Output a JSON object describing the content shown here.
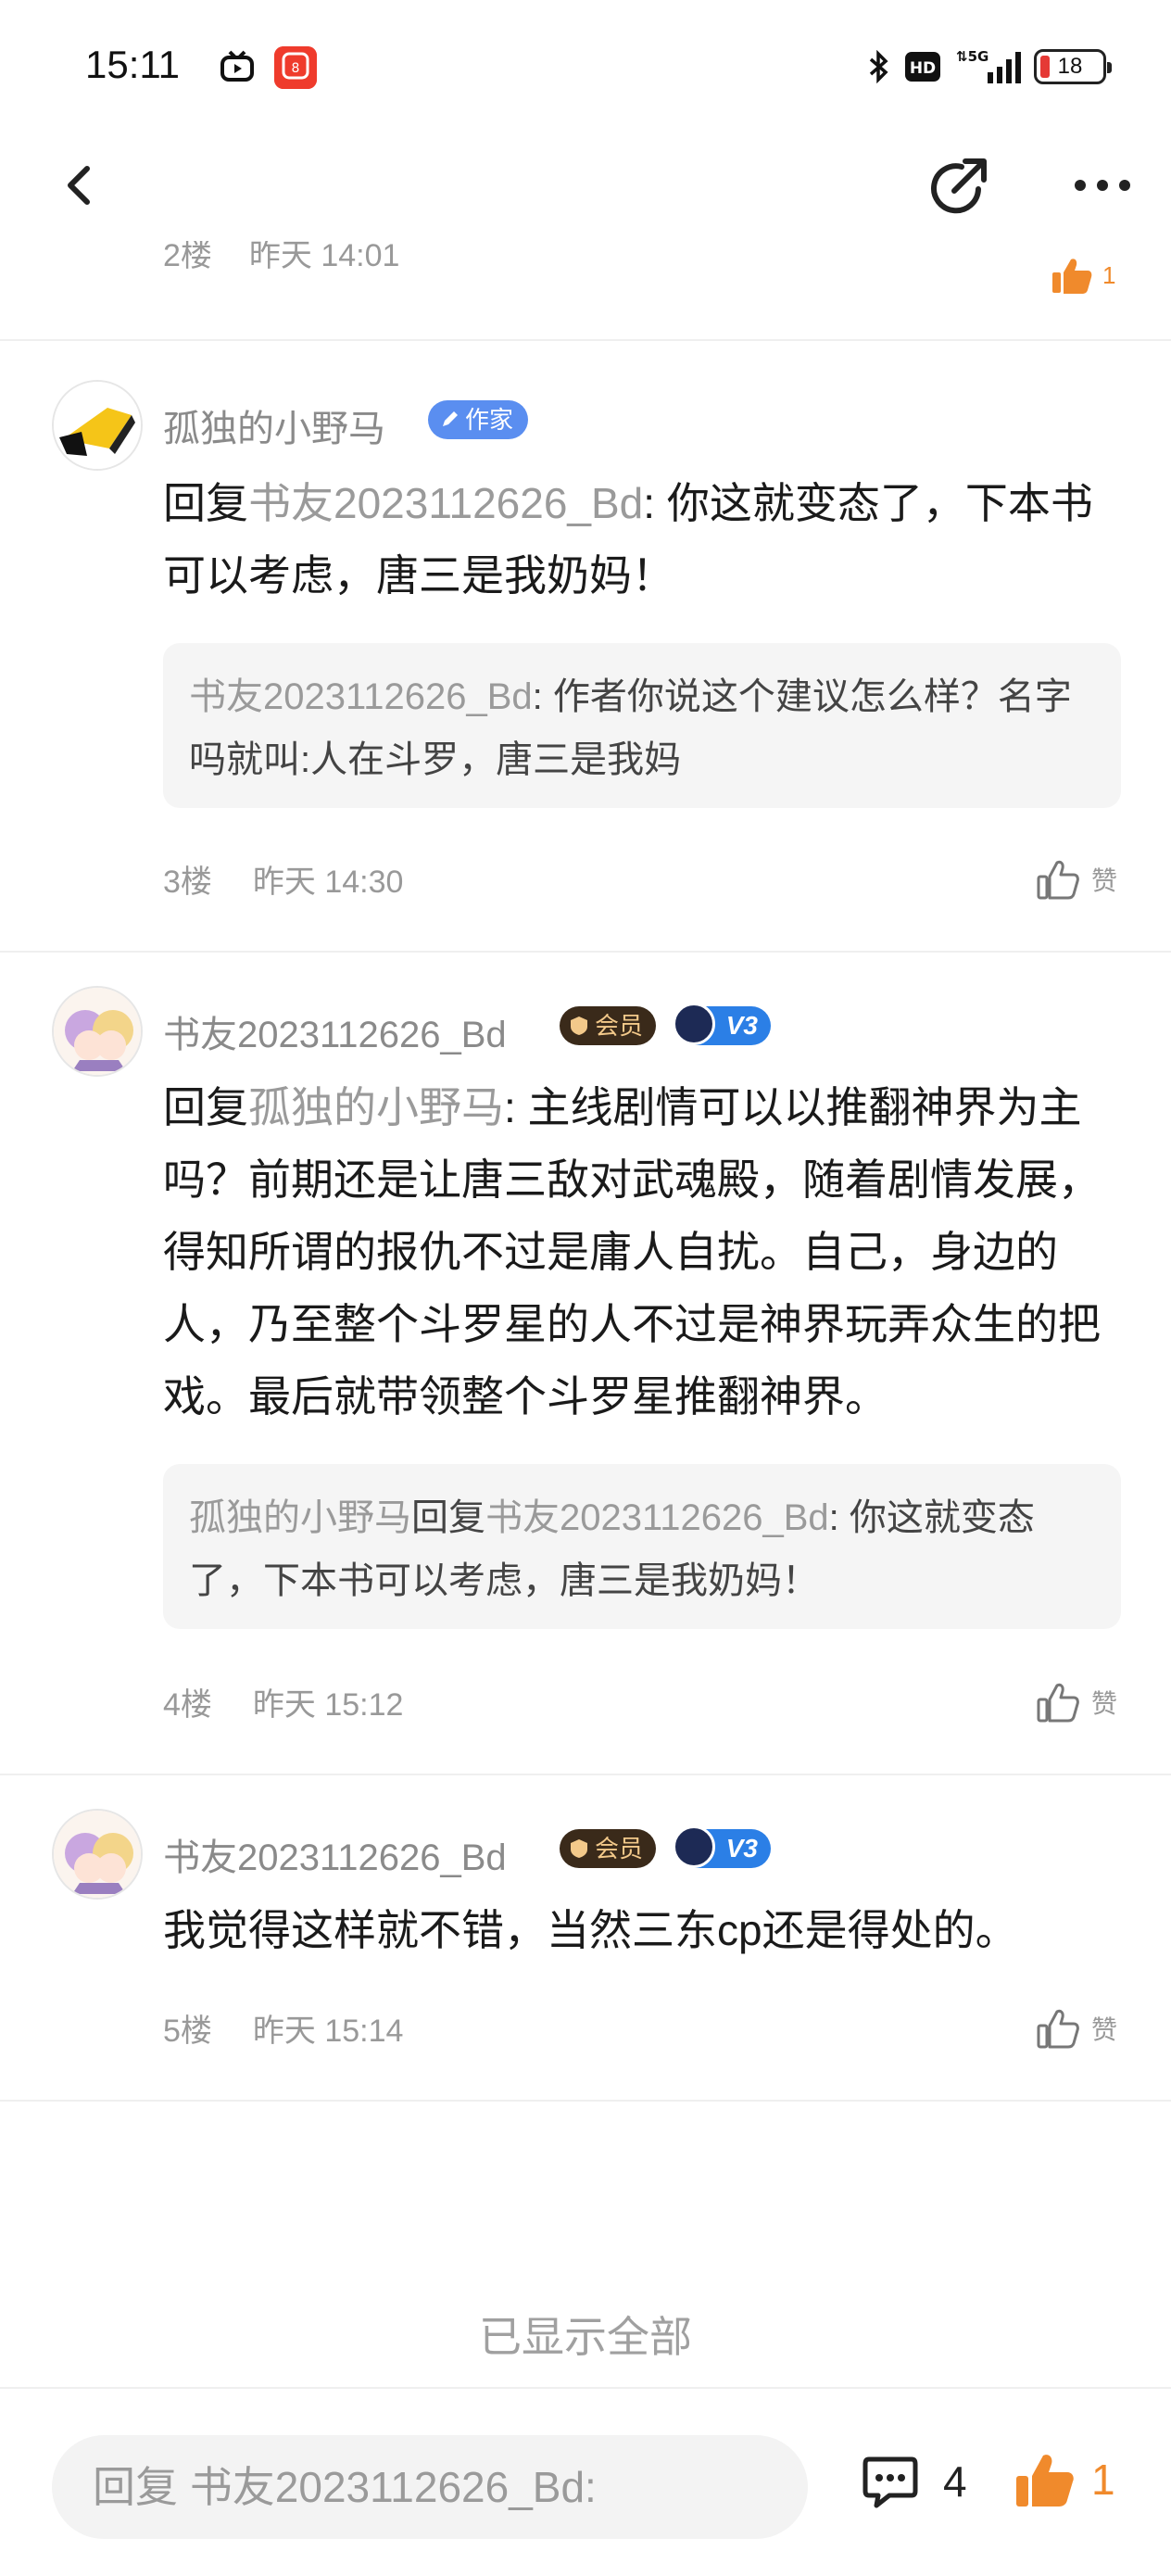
{
  "status_bar": {
    "time": "15:11",
    "battery": "18",
    "network": "5G",
    "hd": "HD",
    "app_icons": [
      "tv-app-icon",
      "red-app-icon"
    ]
  },
  "nav": {
    "back_icon": "chevron-left-icon",
    "share_icon": "share-icon",
    "more_icon": "more-dots-icon"
  },
  "floor2": {
    "floor": "2楼",
    "time": "昨天 14:01",
    "likes": "1"
  },
  "comments": [
    {
      "username": "孤独的小野马",
      "badge": "作家",
      "reply_prefix": "回复",
      "reply_to": "书友2023112626_Bd",
      "text": ": 你这就变态了，下本书可以考虑，唐三是我奶妈！",
      "quote_user": "书友2023112626_Bd",
      "quote_text": ": 作者你说这个建议怎么样？名字吗就叫:人在斗罗，唐三是我妈",
      "floor": "3楼",
      "time": "昨天 14:30",
      "like_label": "赞"
    },
    {
      "username": "书友2023112626_Bd",
      "badge_member": "会员",
      "badge_level": "V3",
      "reply_prefix": "回复",
      "reply_to": "孤独的小野马",
      "text": ": 主线剧情可以以推翻神界为主吗？前期还是让唐三敌对武魂殿，随着剧情发展，得知所谓的报仇不过是庸人自扰。自己，身边的人，乃至整个斗罗星的人不过是神界玩弄众生的把戏。最后就带领整个斗罗星推翻神界。",
      "quote_user": "孤独的小野马",
      "quote_mid": "回复",
      "quote_user2": "书友2023112626_Bd",
      "quote_text": ": 你这就变态了，下本书可以考虑，唐三是我奶妈！",
      "floor": "4楼",
      "time": "昨天 15:12",
      "like_label": "赞"
    },
    {
      "username": "书友2023112626_Bd",
      "badge_member": "会员",
      "badge_level": "V3",
      "text": "我觉得这样就不错，当然三东cp还是得处的。",
      "floor": "5楼",
      "time": "昨天 15:14",
      "like_label": "赞"
    }
  ],
  "footer_note": "已显示全部",
  "bottom_bar": {
    "reply_placeholder": "回复 书友2023112626_Bd:",
    "comment_count": "4",
    "like_count": "1"
  },
  "colors": {
    "accent_orange": "#f08a2c",
    "author_badge": "#5a8ef0",
    "mention_gray": "#9a9a9a"
  }
}
